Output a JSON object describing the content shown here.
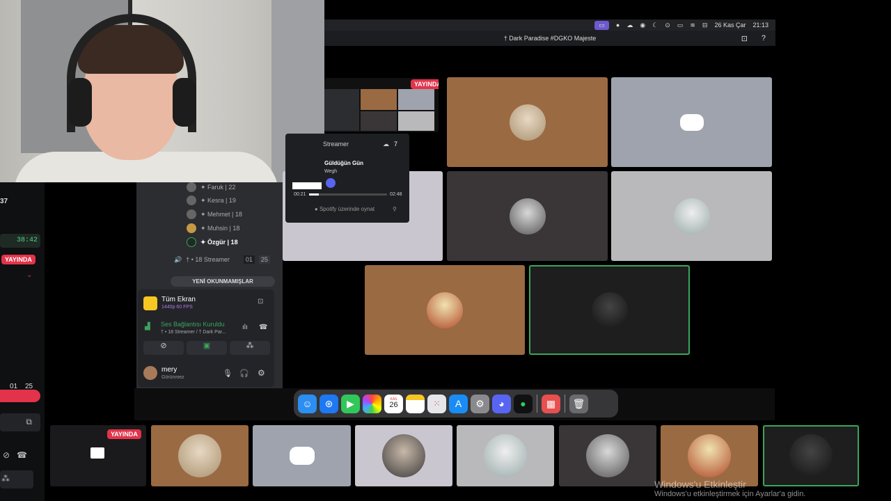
{
  "menubar": {
    "date": "26 Kas Çar",
    "time": "21:13"
  },
  "window_title": "† Dark Paradise #DGKO Majeste",
  "live_badge": "YAYINDA",
  "left_strip": {
    "counter": "37",
    "timer": "38:42",
    "live": "YAYINDA",
    "count_a": "01",
    "count_b": "25"
  },
  "members": [
    {
      "name": "✦ Faruk | 22"
    },
    {
      "name": "✦ Kesra | 19"
    },
    {
      "name": "✦ Mehmet | 18"
    },
    {
      "name": "✦ Muhsin | 18"
    },
    {
      "name": "✦ Özgür | 18"
    }
  ],
  "voice_channel": {
    "name": "† • 18 Streamer",
    "count_a": "01",
    "count_b": "25"
  },
  "unread_label": "YENİ OKUNMAMIŞLAR",
  "screen_share": {
    "title": "Tüm Ekran",
    "subtitle": "1440p 60 FPS"
  },
  "connection": {
    "status": "Ses Bağlantısı Kuruldu",
    "channel": "† • 18 Streamer / † Dark Par..."
  },
  "user": {
    "name": "mery",
    "status": "Görünmez"
  },
  "spotify": {
    "channel": "Streamer",
    "listeners": "7",
    "song": "Güldüğün Gün",
    "artist": "Wegh",
    "elapsed": "00:21",
    "duration": "02:48",
    "play_label": "Spotify üzerinde oynat",
    "progress": 0.125
  },
  "dock": {
    "calendar_month": "KAS",
    "calendar_day": "26",
    "icons": [
      "finder-icon",
      "safari-icon",
      "facetime-icon",
      "photos-icon",
      "calendar-icon",
      "notes-icon",
      "launchpad-icon",
      "appstore-icon",
      "settings-icon",
      "discord-icon",
      "spotify-icon",
      "screensharing-icon",
      "trash-icon"
    ]
  },
  "colors": {
    "brown": "#9a6a42",
    "slate": "#9ea3ad",
    "lavender": "#c9c6d0",
    "dark": "#3a3638",
    "light": "#b9b9bb",
    "live": "#e2334a",
    "discord_blurple": "#5865f2",
    "active_border": "#3ba55d"
  },
  "watermark": {
    "line1": "Windows'u Etkinleştir",
    "line2": "Windows'u etkinleştirmek için Ayarlar'a gidin."
  }
}
